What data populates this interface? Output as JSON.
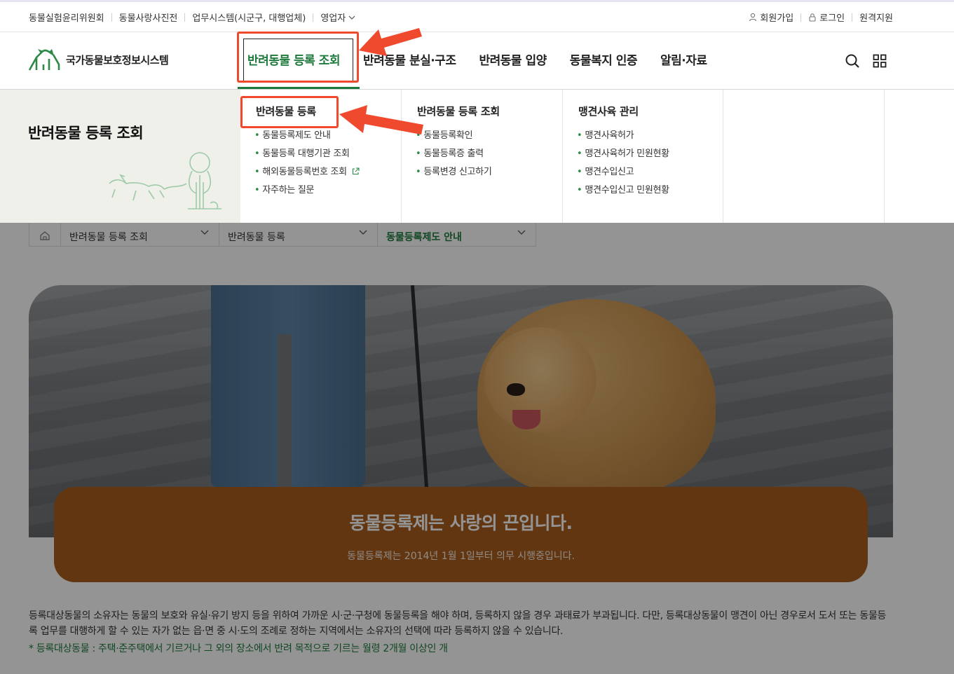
{
  "util": {
    "left": [
      "동물실험윤리위원회",
      "동물사랑사진전",
      "업무시스템(시군구, 대행업체)",
      "영업자"
    ],
    "join": "회원가입",
    "login": "로그인",
    "remote": "원격지원"
  },
  "header": {
    "logo": "국가동물보호정보시스템",
    "gnb": [
      "반려동물 등록 조회",
      "반려동물 분실·구조",
      "반려동물 입양",
      "동물복지 인증",
      "알림·자료"
    ]
  },
  "mega": {
    "title": "반려동물 등록 조회",
    "columns": [
      {
        "heading": "반려동물 등록",
        "items": [
          "동물등록제도 안내",
          "동물등록 대행기관 조회",
          "해외동물등록번호 조회",
          "자주하는 질문"
        ]
      },
      {
        "heading": "반려동물 등록 조회",
        "items": [
          "동물등록확인",
          "동물등록증 출력",
          "등록변경 신고하기"
        ]
      },
      {
        "heading": "맹견사육 관리",
        "items": [
          "맹견사육허가",
          "맹견사육허가 민원현황",
          "맹견수입신고",
          "맹견수입신고 민원현황"
        ]
      }
    ]
  },
  "breadcrumb": [
    "반려동물 등록 조회",
    "반려동물 등록",
    "동물등록제도 안내"
  ],
  "hero": {
    "title": "동물등록제는 사랑의 끈입니다.",
    "subtitle": "동물등록제는 2014년 1월 1일부터 의무 시행중입니다."
  },
  "content": {
    "description": "등록대상동물의 소유자는 동물의 보호와 유실·유기 방지 등을 위하여 가까운 시·군·구청에 동물등록을 해야 하며, 등록하지 않을 경우 과태료가 부과됩니다. 다만, 등록대상동물이 맹견이 아닌 경우로서 도서 또는 동물등록 업무를 대행하게 할 수 있는 자가 없는 읍·면 중 시·도의 조례로 정하는 지역에서는 소유자의 선택에 따라 등록하지 않을 수 있습니다.",
    "note": "* 등록대상동물 : 주택·준주택에서 기르거나 그 외의 장소에서 반려 목적으로 기르는 월령 2개월 이상인 개"
  },
  "colors": {
    "brand_green": "#1e7a3c",
    "hero_box": "#a75d1c",
    "annotation": "#ef4a2d"
  }
}
